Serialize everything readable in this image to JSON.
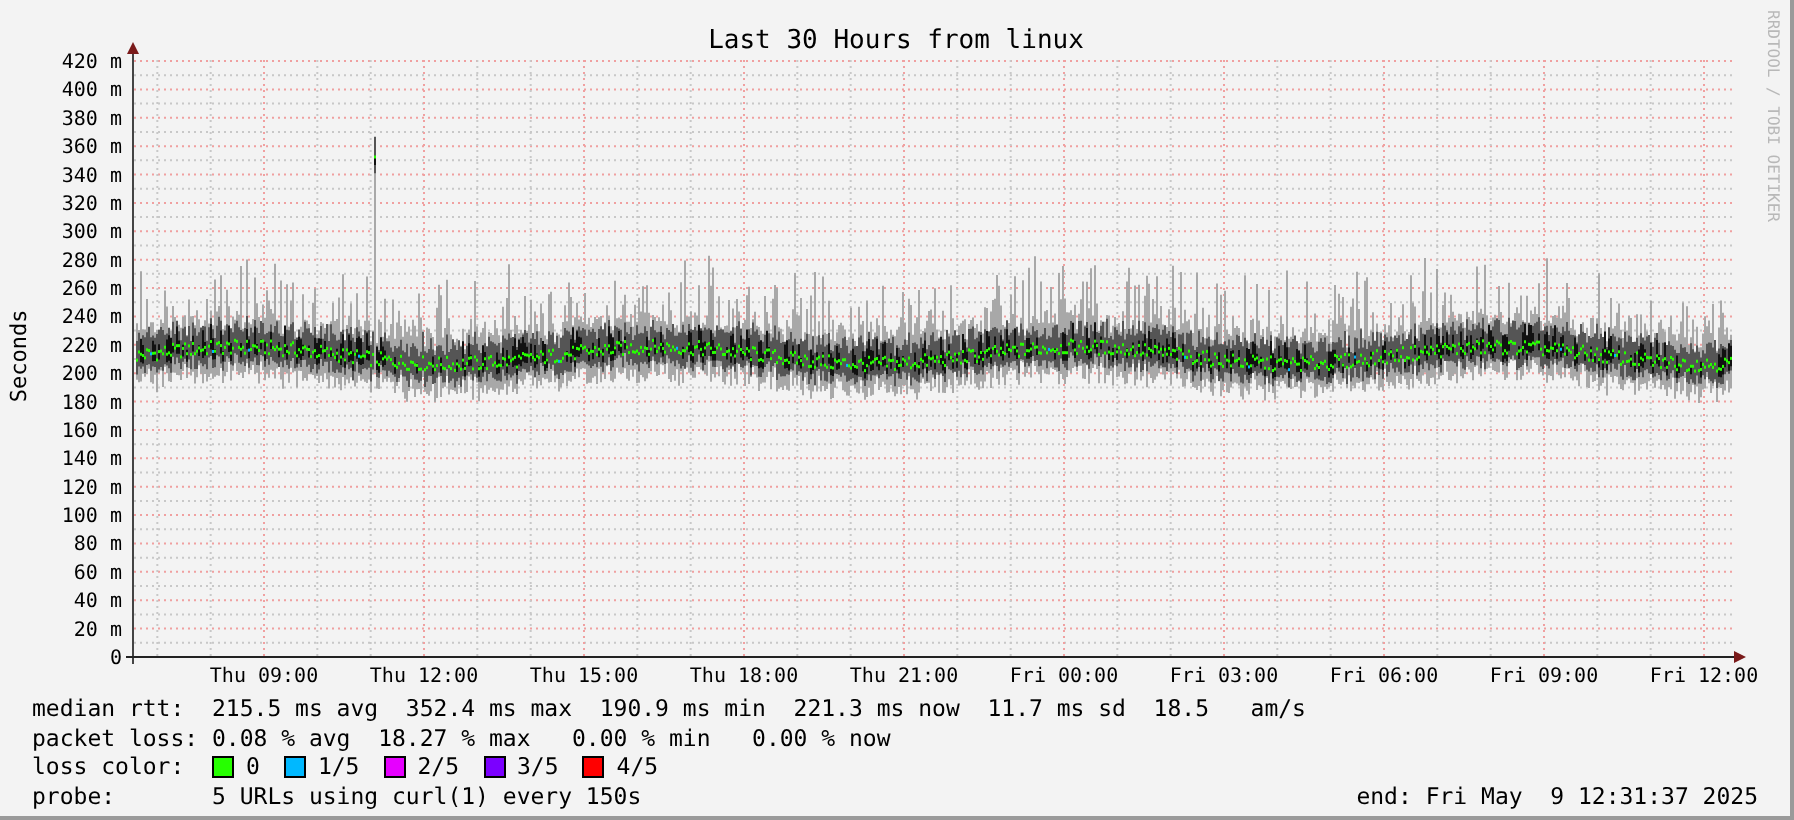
{
  "title": "Last 30 Hours from linux",
  "y_axis_title": "Seconds",
  "credit": "RRDTOOL / TOBI OETIKER",
  "y_ticks": [
    "420 m",
    "400 m",
    "380 m",
    "360 m",
    "340 m",
    "320 m",
    "300 m",
    "280 m",
    "260 m",
    "240 m",
    "220 m",
    "200 m",
    "180 m",
    "160 m",
    "140 m",
    "120 m",
    "100 m",
    "80 m",
    "60 m",
    "40 m",
    "20 m",
    "0"
  ],
  "x_ticks": [
    "Thu 09:00",
    "Thu 12:00",
    "Thu 15:00",
    "Thu 18:00",
    "Thu 21:00",
    "Fri 00:00",
    "Fri 03:00",
    "Fri 06:00",
    "Fri 09:00",
    "Fri 12:00"
  ],
  "legend": [
    {
      "label": "median rtt:",
      "text": "215.5 ms avg  352.4 ms max  190.9 ms min  221.3 ms now  11.7 ms sd  18.5   am/s"
    },
    {
      "label": "packet loss:",
      "text": "0.08 % avg  18.27 % max   0.00 % min   0.00 % now"
    }
  ],
  "loss_colors": {
    "label": "loss color:",
    "items": [
      {
        "label": "0",
        "color": "#26ff00"
      },
      {
        "label": "1/5",
        "color": "#00b8ff"
      },
      {
        "label": "2/5",
        "color": "#e600ff"
      },
      {
        "label": "3/5",
        "color": "#7b00ff"
      },
      {
        "label": "4/5",
        "color": "#ff0000"
      }
    ]
  },
  "probe": {
    "label": "probe:",
    "text": "5 URLs using curl(1) every 150s"
  },
  "end": "end: Fri May  9 12:31:37 2025"
}
